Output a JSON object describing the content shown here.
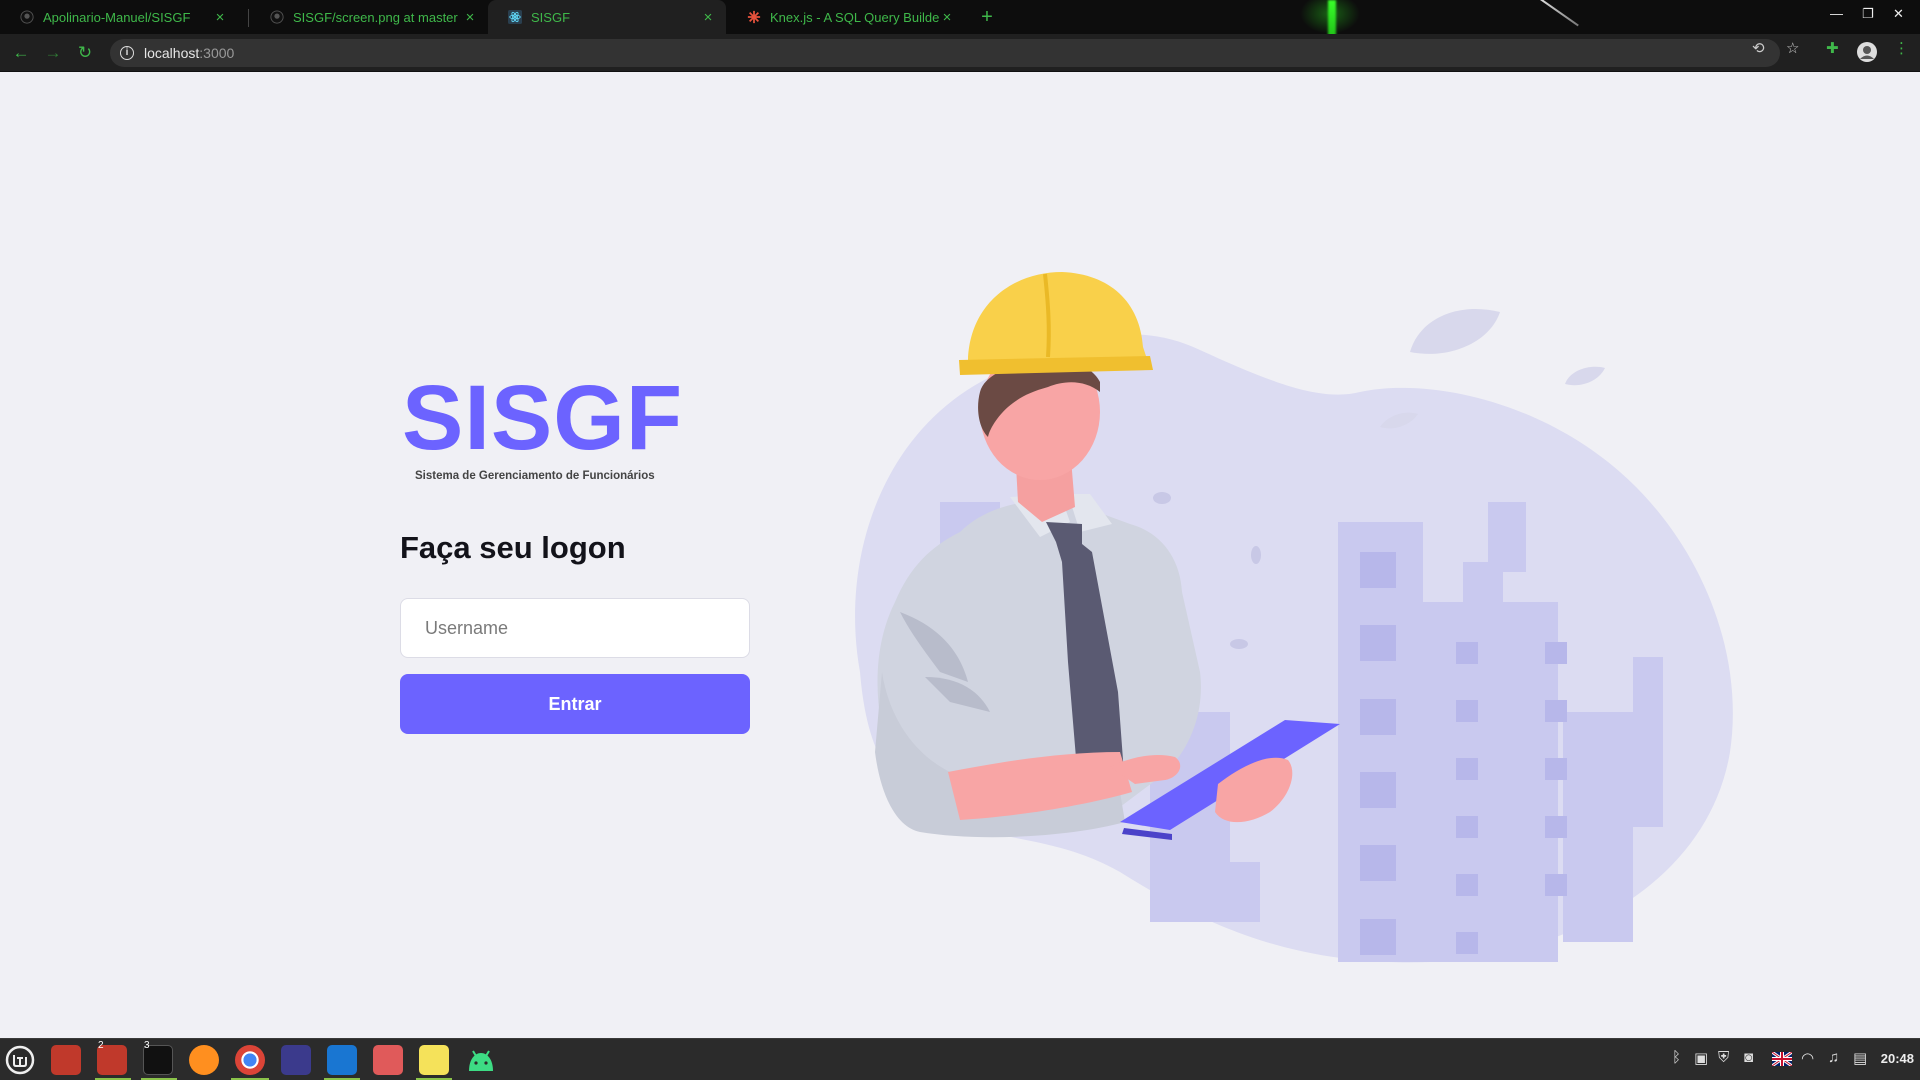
{
  "browser": {
    "tabs": [
      {
        "title": "Apolinario-Manuel/SISGF",
        "icon": "github-icon",
        "close": "×"
      },
      {
        "title": "SISGF/screen.png at master · A",
        "icon": "github-icon",
        "close": "×"
      },
      {
        "title": "SISGF",
        "icon": "react-icon",
        "close": "×"
      },
      {
        "title": "Knex.js - A SQL Query Builder",
        "icon": "knex-icon",
        "close": "×"
      }
    ],
    "new_tab": "+",
    "window_controls": {
      "minimize": "—",
      "restore": "❐",
      "close": "✕"
    },
    "nav": {
      "back": "←",
      "forward": "→",
      "reload": "↻"
    },
    "url_host": "localhost",
    "url_port": ":3000",
    "info_icon": "i",
    "right_icons": {
      "translate": "⟲",
      "bookmark": "☆",
      "extensions": "✚",
      "menu": "⋮"
    }
  },
  "page": {
    "logo": "SISGF",
    "logo_subtitle": "Sistema de Gerenciamento de Funcionários",
    "heading": "Faça seu logon",
    "username_placeholder": "Username",
    "submit_label": "Entrar"
  },
  "taskbar": {
    "badges": {
      "files": "2",
      "terminal": "3"
    },
    "clock": "20:48"
  },
  "colors": {
    "accent": "#6c63ff",
    "page_bg": "#f0f0f5",
    "tab_text": "#3fb84a",
    "helmet": "#f9d04a"
  }
}
